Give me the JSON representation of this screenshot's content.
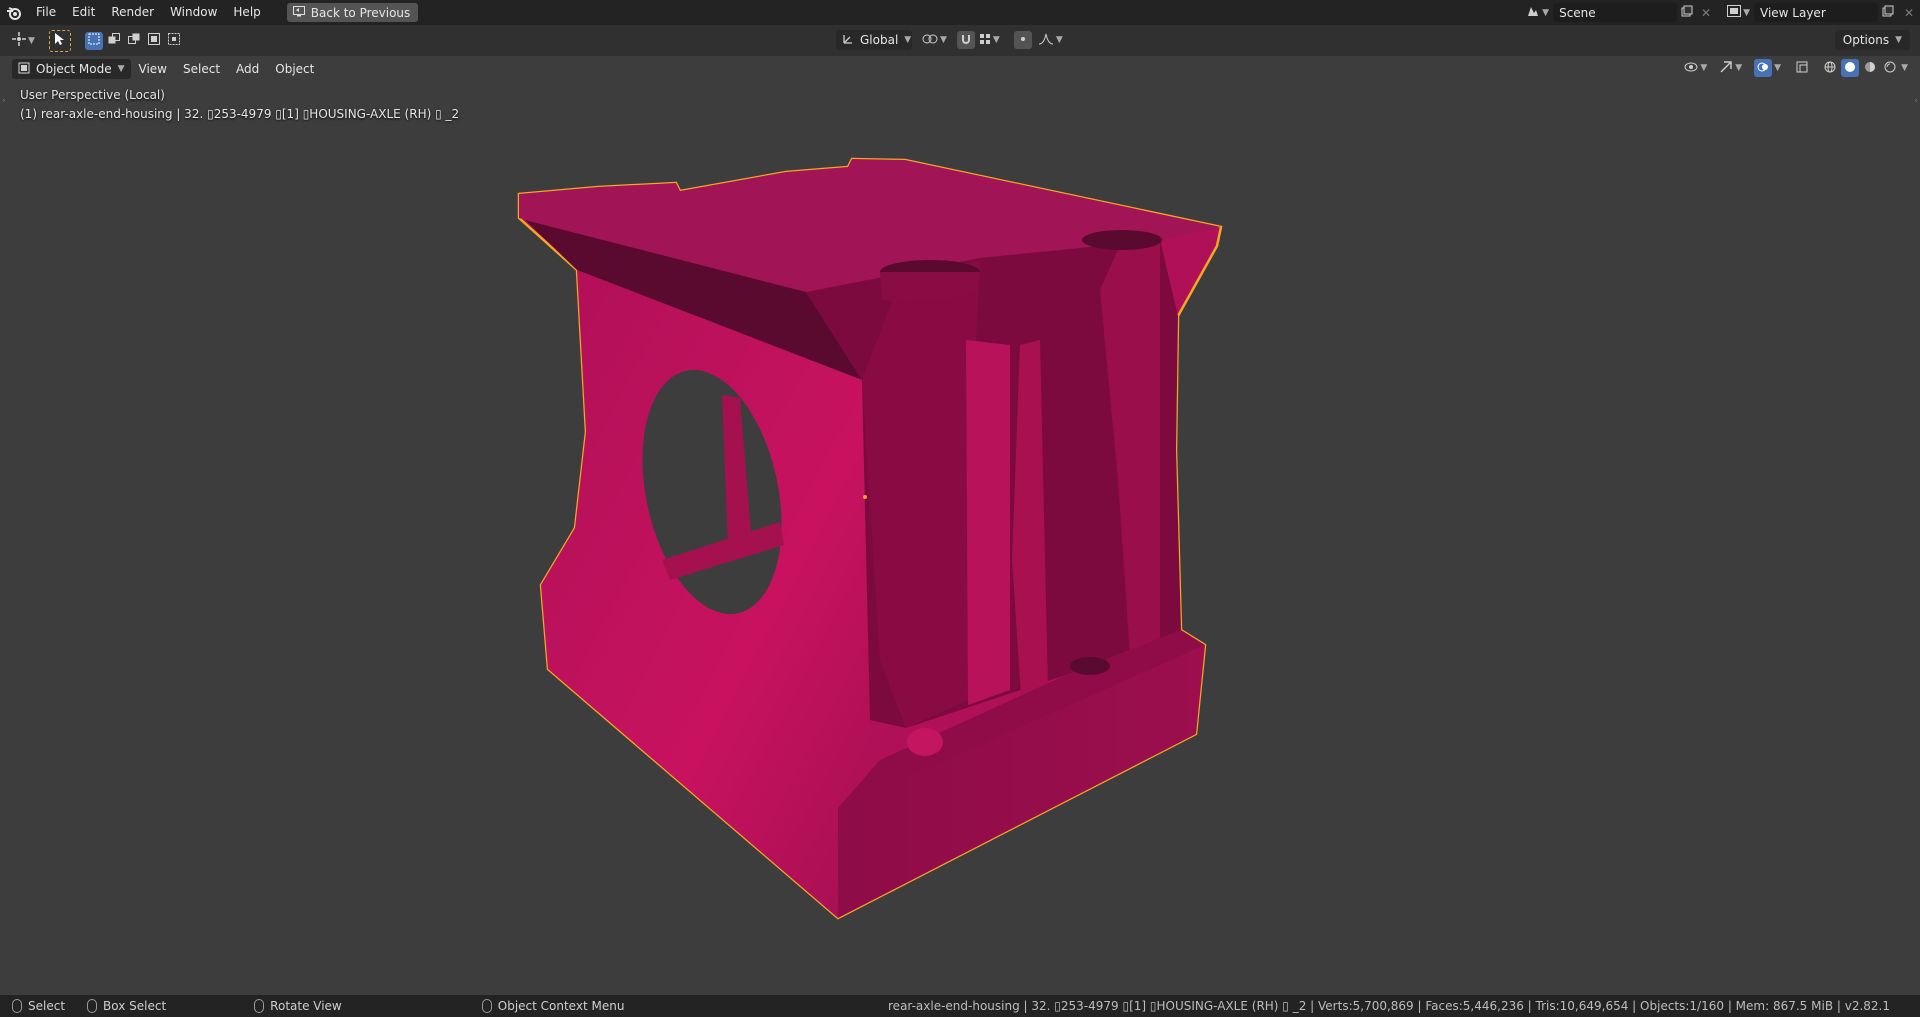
{
  "topbar": {
    "menus": [
      "File",
      "Edit",
      "Render",
      "Window",
      "Help"
    ],
    "back_button": "Back to Previous",
    "scene": "Scene",
    "view_layer": "View Layer"
  },
  "header": {
    "transform_orientation": "Global",
    "options_label": "Options"
  },
  "viewport_header": {
    "mode": "Object Mode",
    "menus": [
      "View",
      "Select",
      "Add",
      "Object"
    ]
  },
  "viewport": {
    "perspective_label": "User Perspective (Local)",
    "object_label": "(1) rear-axle-end-housing | 32. ▯253-4979 ▯[1] ▯HOUSING-AXLE (RH) ▯ _2"
  },
  "statusbar": {
    "select": "Select",
    "box_select": "Box Select",
    "rotate_view": "Rotate View",
    "context_menu": "Object Context Menu",
    "stats": "rear-axle-end-housing | 32. ▯253-4979 ▯[1] ▯HOUSING-AXLE (RH) ▯ _2 | Verts:5,700,869 | Faces:5,446,236 | Tris:10,649,654 | Objects:1/160 | Mem: 867.5 MiB | v2.82.1"
  },
  "colors": {
    "object_fill": "#b0105a",
    "selection_outline": "#f5a623",
    "background": "#3d3d3d"
  },
  "icons": [
    "blender-logo-icon",
    "back-icon",
    "scene-icon",
    "view-layer-icon",
    "cursor-icon",
    "select-box-icon",
    "pivot-icon",
    "snap-icon",
    "proportional-icon",
    "visibility-icon",
    "gizmo-icon",
    "overlay-icon",
    "xray-icon",
    "wireframe-icon",
    "solid-icon",
    "material-icon",
    "rendered-icon",
    "mouse-icon"
  ]
}
